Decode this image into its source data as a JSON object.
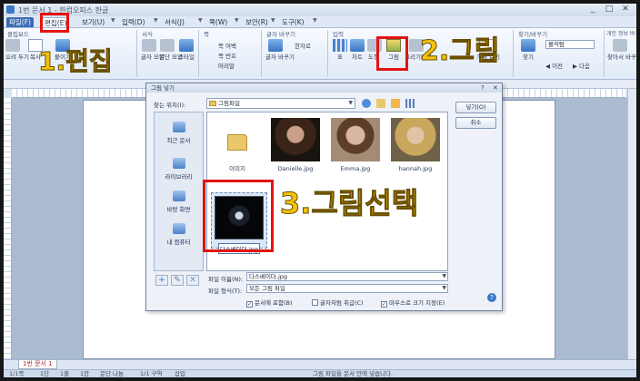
{
  "titlebar": {
    "title": "1번 문서 1 - 한컴오피스 한글",
    "min": "_",
    "restore": "□",
    "close": "✕"
  },
  "menu": {
    "file": "파일(F)",
    "edit": "편집(E)",
    "tabs": [
      "보기(U)",
      "입력(D)",
      "서식(J)",
      "쪽(W)",
      "보안(R)",
      "도구(K)"
    ]
  },
  "ribbon": {
    "groups": [
      "클립보드",
      "서식",
      "쪽",
      "글자 바꾸기",
      "입력",
      "찾기/바꾸기",
      "개인 정보 바꾸기"
    ],
    "buttons": {
      "cut": "오려 두기",
      "copy": "복사",
      "paste": "붙이기",
      "text_style": "글자 모양",
      "para_style": "문단 모양",
      "style": "스타일",
      "page_border": "쪽 여백",
      "page_num": "쪽 번호",
      "header": "머리말",
      "char_change": "글자 바꾸기",
      "hanja": "한자로",
      "table": "표",
      "chart": "차트",
      "shape": "도형",
      "picture": "그림",
      "clip": "그리기마당",
      "media": "멀티미디어",
      "object": "개체 보기",
      "find": "찾기",
      "prev": "◀ 이전",
      "next": "▶ 다음",
      "replace": "바꾸기",
      "find_replace": "찾아서 바꾸기"
    },
    "find_box": "몰적탐",
    "zoom": "바닥글"
  },
  "dialog": {
    "title": "그림 넣기",
    "help_btn": "?",
    "close_btn": "✕",
    "lookin_label": "찾는 위치(I):",
    "lookin_value": "그림파일",
    "places": [
      "최근 문서",
      "라이브러리",
      "바탕 화면",
      "내 컴퓨터"
    ],
    "files": [
      "이미지",
      "Danielle.jpg",
      "Emma.jpg",
      "hannah.jpg",
      "다스베이더.jpg"
    ],
    "open_btn": "넣기(O)",
    "cancel_btn": "취소",
    "filename_label": "파일 이름(N):",
    "filename_value": "다스베이더.jpg",
    "filetype_label": "파일 형식(T):",
    "filetype_value": "모든 그림 파일",
    "checkboxes": [
      {
        "label": "문서에 포함(B)",
        "checked": true
      },
      {
        "label": "글자처럼 취급(C)",
        "checked": false
      },
      {
        "label": "마우스로 크기 지정(E)",
        "checked": true
      }
    ]
  },
  "doc": {
    "tab": "1번 문서 1"
  },
  "status": {
    "items": [
      "1/1쪽",
      "1단",
      "1줄",
      "1칸",
      "문단 나눔",
      "1/1 구역",
      "삽입"
    ],
    "message": "그림 파일을 문서 안에 넣습니다."
  },
  "annotations": {
    "step1": "1.편집",
    "step2": "2.그림",
    "step3": "3.그림선택"
  },
  "colors": {
    "annotation_box": "#e31212",
    "annotation_text": "#f2c20c",
    "accent": "#3b6db5"
  }
}
